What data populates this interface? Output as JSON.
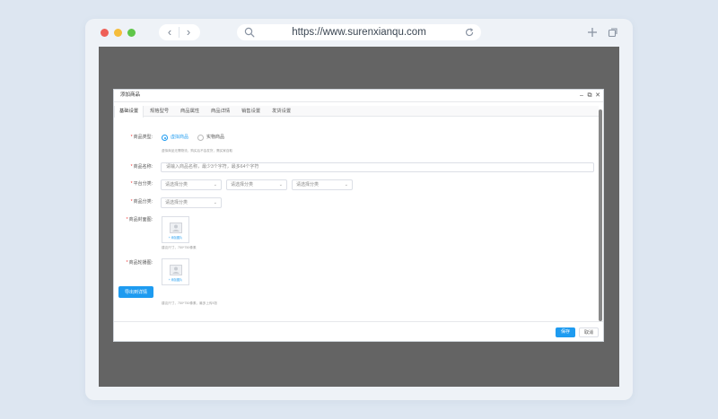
{
  "browser": {
    "url": "https://www.surenxianqu.com",
    "icons": [
      "back-icon",
      "forward-icon",
      "search-icon",
      "reload-icon",
      "new-tab-icon",
      "tabs-icon"
    ]
  },
  "dialog": {
    "title": "添加商品",
    "controls": {
      "minimize": "–",
      "maximize": "⧉",
      "close": "✕"
    },
    "tabs": [
      "基础设置",
      "规格型号",
      "商品属性",
      "商品详情",
      "销售设置",
      "发货设置"
    ],
    "form": {
      "product_type": {
        "label": "商品类型:",
        "options": [
          "虚拟商品",
          "实物商品"
        ],
        "selected": "虚拟商品",
        "hint": "虚拟商品无需物流，购买后不会发货，需买家自取"
      },
      "product_name": {
        "label": "商品名称:",
        "placeholder": "请输入商品名称，最少3个字符，最多64个字符"
      },
      "platform_category": {
        "label": "平台分类:",
        "selects": [
          "请选择分类",
          "请选择分类",
          "请选择分类"
        ]
      },
      "product_category": {
        "label": "商品分类:",
        "selects": [
          "请选择分类"
        ]
      },
      "cover_image": {
        "label": "商品封面图:",
        "upload_text": "+ 添加图片",
        "hint": "建议尺寸，750*750像素"
      },
      "carousel_image": {
        "label": "商品轮播图:",
        "upload_text": "+ 添加图片",
        "hint": "建议尺寸，750*750像素，最多上传5张"
      },
      "export_button": "导出到详情"
    },
    "footer": {
      "save": "保存",
      "cancel": "取消"
    }
  },
  "colors": {
    "accent": "#1e9bf0",
    "required": "#ee3333",
    "viewport_bg": "#646464",
    "page_bg": "#dde6f1"
  }
}
